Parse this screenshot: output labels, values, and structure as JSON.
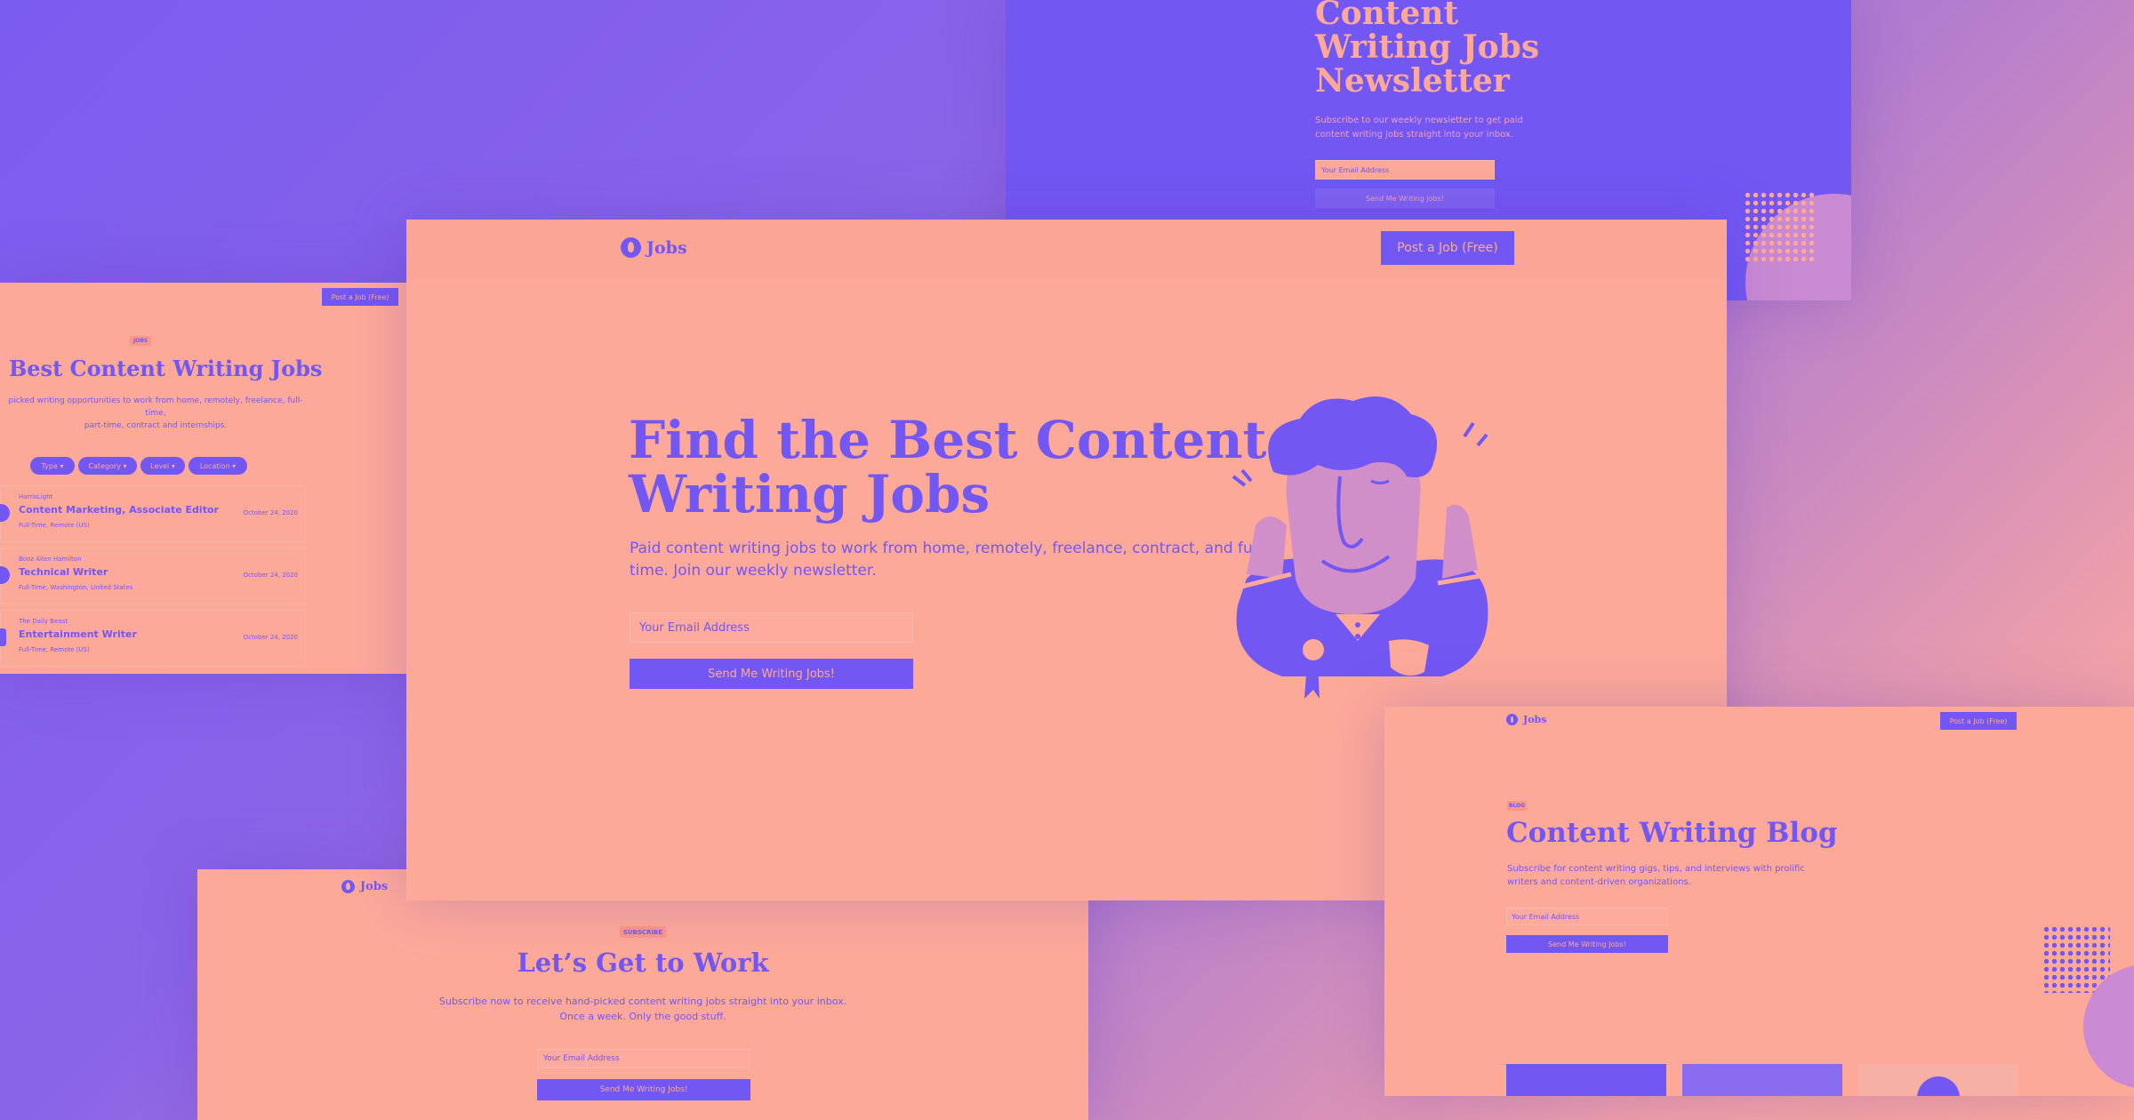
{
  "newsletter_panel": {
    "title_lines": [
      "Content",
      "Writing Jobs",
      "Newsletter"
    ],
    "description": "Subscribe to our weekly newsletter to get paid content writing jobs straight into your inbox.",
    "email_placeholder": "Your Email Address",
    "button_label": "Send Me Writing Jobs!"
  },
  "jobs_panel": {
    "post_button": "Post a Job (Free)",
    "badge": "JOBS",
    "title": "Best Content Writing Jobs",
    "description_line1": "picked writing opportunities to work from home, remotely, freelance, full-time,",
    "description_line2": "part-time, contract and internships.",
    "filters": [
      "Type",
      "Category",
      "Level",
      "Location"
    ],
    "jobs": [
      {
        "company": "HarrisLight",
        "title": "Content Marketing, Associate Editor",
        "meta": "Full-Time, Remote (US)",
        "date": "October 24, 2020"
      },
      {
        "company": "Booz Allen Hamilton",
        "title": "Technical Writer",
        "meta": "Full-Time, Washington, United States",
        "date": "October 24, 2020"
      },
      {
        "company": "The Daily Beast",
        "title": "Entertainment Writer",
        "meta": "Full-Time, Remote (US)",
        "date": "October 24, 2020"
      }
    ]
  },
  "hero": {
    "logo_text": "Jobs",
    "post_button": "Post a Job (Free)",
    "headline_line1": "Find the Best Content",
    "headline_line2": "Writing Jobs",
    "subtitle_line1": "Paid content writing jobs to work from home, remotely, freelance, contract, and full-",
    "subtitle_line2": "time. Join our weekly newsletter.",
    "email_placeholder": "Your Email Address",
    "button_label": "Send Me Writing Jobs!"
  },
  "subscribe_panel": {
    "logo_text": "Jobs",
    "badge": "SUBSCRIBE",
    "title": "Let’s Get to Work",
    "description_line1": "Subscribe now to receive hand-picked content writing jobs straight into your inbox.",
    "description_line2": "Once a week. Only the good stuff.",
    "email_placeholder": "Your Email Address",
    "button_label": "Send Me Writing Jobs!"
  },
  "blog_panel": {
    "logo_text": "Jobs",
    "post_button": "Post a Job (Free)",
    "badge": "BLOG",
    "title": "Content Writing Blog",
    "description_line1": "Subscribe for content writing gigs, tips, and interviews with prolific",
    "description_line2": "writers and content-driven organizations.",
    "email_placeholder": "Your Email Address",
    "button_label": "Send Me Writing Jobs!"
  },
  "colors": {
    "accent": "#7257f3",
    "background": "#fda99a"
  }
}
